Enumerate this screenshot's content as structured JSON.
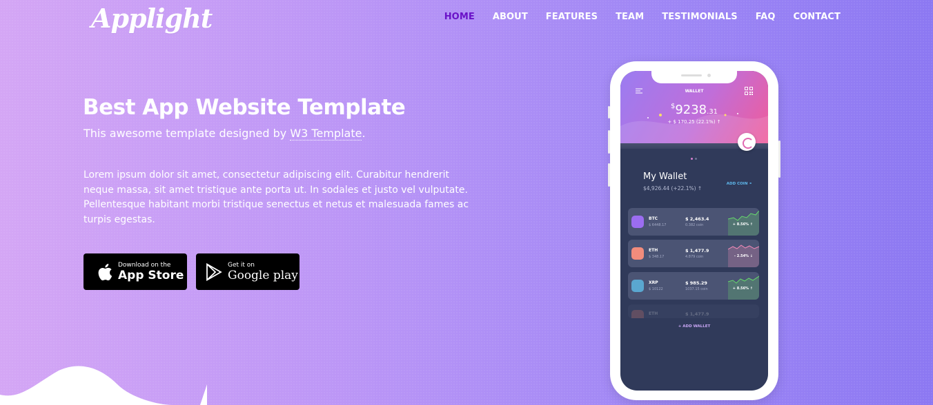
{
  "brand": {
    "logo": "Applight"
  },
  "nav": {
    "items": [
      {
        "label": "HOME",
        "active": true
      },
      {
        "label": "ABOUT"
      },
      {
        "label": "FEATURES"
      },
      {
        "label": "TEAM"
      },
      {
        "label": "TESTIMONIALS"
      },
      {
        "label": "FAQ"
      },
      {
        "label": "CONTACT"
      }
    ]
  },
  "hero": {
    "title": "Best App Website Template",
    "subtitle_prefix": "This awesome template designed by ",
    "subtitle_link": "W3 Template",
    "subtitle_suffix": ".",
    "description": "Lorem ipsum dolor sit amet, consectetur adipiscing elit. Curabitur hendrerit neque massa, sit amet tristique ante porta ut. In sodales et justo vel vulputate. Pellentesque habitant morbi tristique senectus et netus et malesuada fames ac turpis egestas."
  },
  "store_buttons": {
    "apple": {
      "small": "Download on the",
      "big": "App Store"
    },
    "google": {
      "small": "Get it on",
      "big": "Google play"
    }
  },
  "phone": {
    "wallet_label": "WALLET",
    "balance_currency": "$",
    "balance_main": "9238",
    "balance_cents": ".31",
    "balance_change": "+ $ 170.25 (22.1%) ↑",
    "my_wallet_title": "My Wallet",
    "my_wallet_sub": "$4,926.44 (+22.1%) ↑",
    "add_coin": "ADD COIN",
    "add_wallet": "+ ADD WALLET",
    "coins": [
      {
        "sym": "BTC",
        "usd": "$ 6448.17",
        "price": "$ 2,463.4",
        "amount": "0.382 coin",
        "pct": "+ 8.56% ↑",
        "trend": "up",
        "color": "#9b6df0"
      },
      {
        "sym": "ETH",
        "usd": "$ 348.17",
        "price": "$ 1,477.9",
        "amount": "4.879 coin",
        "pct": "- 2.54% ↓",
        "trend": "down",
        "color": "#f28c7c"
      },
      {
        "sym": "XRP",
        "usd": "$ 10122",
        "price": "$ 985.29",
        "amount": "1037.15 coin",
        "pct": "+ 8.56% ↑",
        "trend": "up",
        "color": "#5aa7d0"
      },
      {
        "sym": "ETH",
        "usd": "",
        "price": "$ 1,477.9",
        "amount": "",
        "pct": "",
        "trend": "down",
        "color": "#f28c7c"
      }
    ]
  },
  "colors": {
    "nav_active": "#6a12c8",
    "up": "#66d96c",
    "down": "#f28ab8"
  }
}
